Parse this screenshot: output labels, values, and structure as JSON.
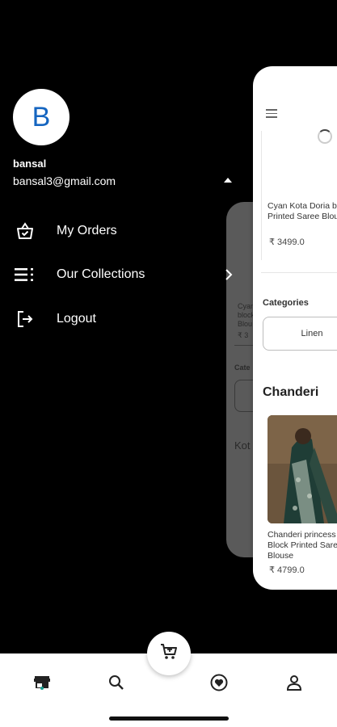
{
  "drawer": {
    "avatar_initial": "B",
    "user_name": "bansal",
    "user_email": "bansal3@gmail.com",
    "menu": [
      {
        "label": "My Orders",
        "icon": "basket-check-icon"
      },
      {
        "label": "Our Collections",
        "icon": "list-icon"
      },
      {
        "label": "Logout",
        "icon": "logout-icon"
      }
    ]
  },
  "card": {
    "product1_title": "Cyan Kota Doria block Printed Saree Blouse",
    "product1_price": "₹ 3499.0",
    "categories_label": "Categories",
    "category_chip": "Linen",
    "section_title": "Chanderi",
    "product2_title": "Chanderi princess Hand Block Printed Saree with Blouse",
    "product2_price": "₹ 4799.0"
  },
  "card_back": {
    "text1": "Cyan",
    "text2": "block",
    "text3": "Blou",
    "price": "₹ 3",
    "categories": "Cate",
    "section": "Kot"
  },
  "nav": {
    "items": [
      "store-icon",
      "search-icon",
      "heart-icon",
      "person-icon"
    ],
    "fab_icon": "cart-icon"
  }
}
